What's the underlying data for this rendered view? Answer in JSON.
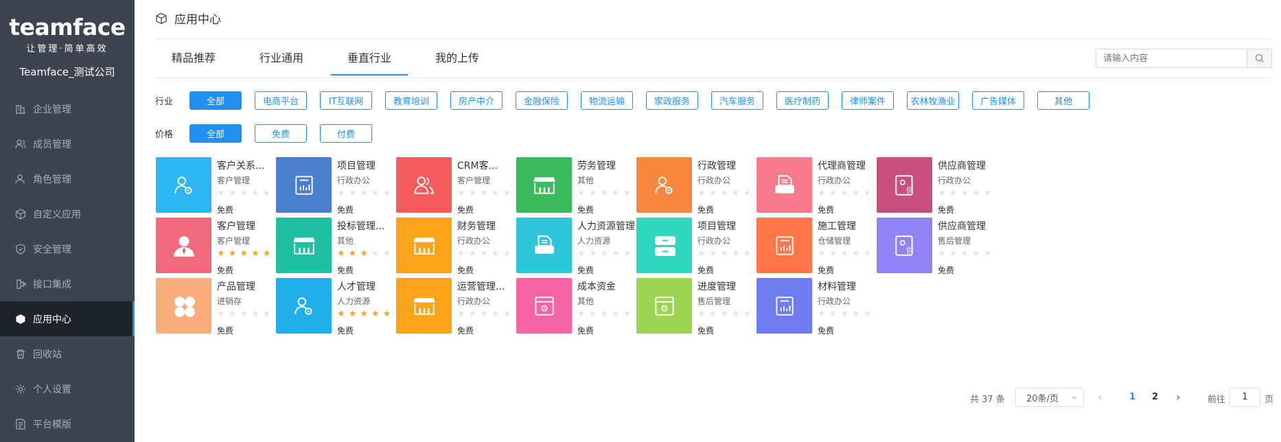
{
  "brand": {
    "logo": "teamface",
    "slogan": "让管理·简单高效",
    "company": "Teamface_测试公司"
  },
  "nav": [
    {
      "label": "企业管理",
      "icon": "building-icon",
      "active": false
    },
    {
      "label": "成员管理",
      "icon": "users-icon",
      "active": false
    },
    {
      "label": "角色管理",
      "icon": "role-icon",
      "active": false
    },
    {
      "label": "自定义应用",
      "icon": "cube-icon",
      "active": false
    },
    {
      "label": "安全管理",
      "icon": "shield-icon",
      "active": false
    },
    {
      "label": "接口集成",
      "icon": "plug-icon",
      "active": false
    },
    {
      "label": "应用中心",
      "icon": "cube-icon",
      "active": true
    },
    {
      "label": "回收站",
      "icon": "trash-icon",
      "active": false
    },
    {
      "label": "个人设置",
      "icon": "gear-icon",
      "active": false
    },
    {
      "label": "平台模版",
      "icon": "template-icon",
      "active": false
    }
  ],
  "page_title": "应用中心",
  "tabs": [
    {
      "label": "精品推荐"
    },
    {
      "label": "行业通用"
    },
    {
      "label": "垂直行业",
      "active": true
    },
    {
      "label": "我的上传"
    }
  ],
  "search": {
    "placeholder": "请输入内容"
  },
  "filters": {
    "industry": {
      "label": "行业",
      "options": [
        "全部",
        "电商平台",
        "IT互联网",
        "教育培训",
        "房产中介",
        "金融保险",
        "物流运输",
        "家政服务",
        "汽车服务",
        "医疗制药",
        "律师案件",
        "农林牧渔业",
        "广告媒体",
        "其他"
      ],
      "selected": "全部"
    },
    "price": {
      "label": "价格",
      "options": [
        "全部",
        "免费",
        "付费"
      ],
      "selected": "全部"
    }
  },
  "apps": [
    {
      "title": "客户关系...",
      "category": "客户管理",
      "rating": 0,
      "price": "免费",
      "color": "#2eb7f5",
      "icon": "user-gear-icon"
    },
    {
      "title": "项目管理",
      "category": "行政办公",
      "rating": 0,
      "price": "免费",
      "color": "#4a7fce",
      "icon": "chart-doc-icon"
    },
    {
      "title": "CRM客...",
      "category": "客户管理",
      "rating": 0,
      "price": "免费",
      "color": "#f45b5b",
      "icon": "people-icon"
    },
    {
      "title": "劳务管理",
      "category": "其他",
      "rating": 0,
      "price": "免费",
      "color": "#3dba5d",
      "icon": "store-icon"
    },
    {
      "title": "行政管理",
      "category": "行政办公",
      "rating": 0,
      "price": "免费",
      "color": "#f5873e",
      "icon": "user-gear-icon"
    },
    {
      "title": "代理商管理",
      "category": "行政办公",
      "rating": 0,
      "price": "免费",
      "color": "#f77b8d",
      "icon": "printer-icon"
    },
    {
      "title": "供应商管理",
      "category": "行政办公",
      "rating": 0,
      "price": "免费",
      "color": "#c9507d",
      "icon": "supplier-icon"
    },
    {
      "title": "客户管理",
      "category": "客户管理",
      "rating": 5,
      "price": "免费",
      "color": "#f26a7e",
      "icon": "person-icon"
    },
    {
      "title": "投标管理...",
      "category": "其他",
      "rating": 3,
      "price": "免费",
      "color": "#1fbf9f",
      "icon": "store-icon"
    },
    {
      "title": "财务管理",
      "category": "行政办公",
      "rating": 0,
      "price": "免费",
      "color": "#fba31b",
      "icon": "store-icon"
    },
    {
      "title": "人力资源管理",
      "category": "人力资源",
      "rating": 0,
      "price": "免费",
      "color": "#2ec7d9",
      "icon": "printer-icon"
    },
    {
      "title": "项目管理",
      "category": "行政办公",
      "rating": 0,
      "price": "免费",
      "color": "#2fd6be",
      "icon": "cabinet-icon"
    },
    {
      "title": "施工管理",
      "category": "仓储管理",
      "rating": 0,
      "price": "免费",
      "color": "#ff7748",
      "icon": "chart-doc-icon"
    },
    {
      "title": "供应商管理",
      "category": "售后管理",
      "rating": 0,
      "price": "免费",
      "color": "#8f83f5",
      "icon": "supplier-icon"
    },
    {
      "title": "产品管理",
      "category": "进销存",
      "rating": 0,
      "price": "免费",
      "color": "#f8ad7c",
      "icon": "clover-icon"
    },
    {
      "title": "人才管理",
      "category": "人力资源",
      "rating": 5,
      "price": "免费",
      "color": "#22aee8",
      "icon": "user-gear-icon"
    },
    {
      "title": "运营管理...",
      "category": "行政办公",
      "rating": 0,
      "price": "免费",
      "color": "#fba31b",
      "icon": "store-icon"
    },
    {
      "title": "成本资金",
      "category": "其他",
      "rating": 0,
      "price": "免费",
      "color": "#f565a6",
      "icon": "box-gear-icon"
    },
    {
      "title": "进度管理",
      "category": "售后管理",
      "rating": 0,
      "price": "免费",
      "color": "#9ed454",
      "icon": "box-gear-icon"
    },
    {
      "title": "材料管理",
      "category": "行政办公",
      "rating": 0,
      "price": "免费",
      "color": "#6f7cf0",
      "icon": "chart-doc-icon"
    }
  ],
  "pagination": {
    "total_text": "共 37 条",
    "page_size": "20条/页",
    "pages": [
      "1",
      "2"
    ],
    "current": "1",
    "goto_label": "前往",
    "goto_value": "1",
    "page_suffix": "页"
  }
}
